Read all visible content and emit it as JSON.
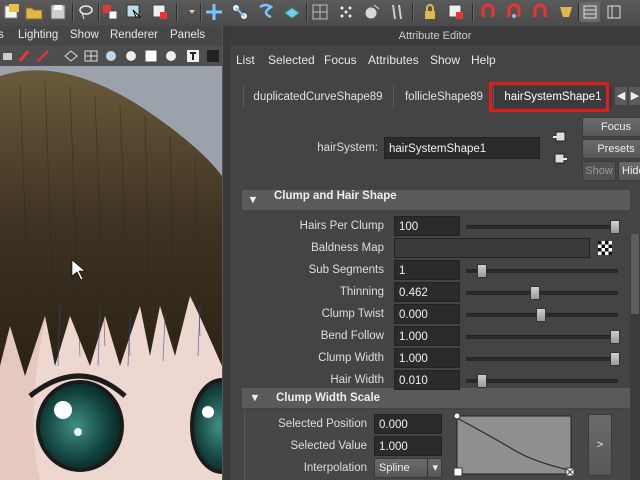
{
  "toolbar": {
    "icons": [
      "select-icon",
      "folder-icon",
      "save-icon",
      "lasso-icon",
      "select-hierarchy-icon",
      "select-object-icon",
      "move-icon",
      "curve-snap-icon",
      "point-snap-icon",
      "plane-snap-icon",
      "grid-icon",
      "surface-snap-icon",
      "camera-icon",
      "lock-icon",
      "attribute-icon",
      "magnet-icon",
      "render-icon",
      "ipr-icon",
      "settings-icon",
      "toggle-panel-icon"
    ]
  },
  "viewport": {
    "menu": [
      "Lighting",
      "Show",
      "Renderer",
      "Panels"
    ]
  },
  "attribute_editor": {
    "title": "Attribute Editor",
    "menu": [
      "List",
      "Selected",
      "Focus",
      "Attributes",
      "Show",
      "Help"
    ],
    "tabs": [
      {
        "label": "duplicatedCurveShape89"
      },
      {
        "label": "follicleShape89"
      },
      {
        "label": "hairSystemShape1",
        "active": true
      }
    ],
    "node_label": "hairSystem:",
    "node_value": "hairSystemShape1",
    "buttons": {
      "focus": "Focus",
      "presets": "Presets",
      "show": "Show",
      "hide": "Hide"
    },
    "section_clump": {
      "title": "Clump and Hair Shape",
      "rows": [
        {
          "label": "Hairs Per Clump",
          "value": "100",
          "slider": 1.0
        },
        {
          "label": "Baldness Map",
          "value": ""
        },
        {
          "label": "Sub Segments",
          "value": "1",
          "slider": 0.1
        },
        {
          "label": "Thinning",
          "value": "0.462",
          "slider": 0.46
        },
        {
          "label": "Clump Twist",
          "value": "0.000",
          "slider": 0.5
        },
        {
          "label": "Bend Follow",
          "value": "1.000",
          "slider": 1.0
        },
        {
          "label": "Clump Width",
          "value": "1.000",
          "slider": 1.0
        },
        {
          "label": "Hair Width",
          "value": "0.010",
          "slider": 0.1
        }
      ]
    },
    "section_width_scale": {
      "title": "Clump Width Scale",
      "selected_position_label": "Selected Position",
      "selected_position": "0.000",
      "selected_value_label": "Selected Value",
      "selected_value": "1.000",
      "interpolation_label": "Interpolation",
      "interpolation": "Spline",
      "expand": ">"
    }
  }
}
